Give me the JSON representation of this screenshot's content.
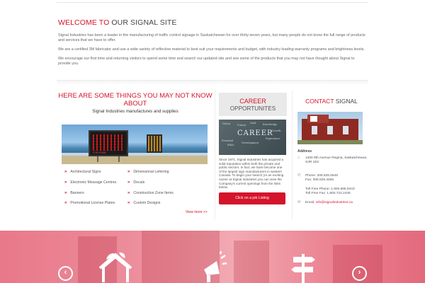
{
  "welcome": {
    "title_red": "WELCOME TO",
    "title_dark": "OUR SIGNAL SITE",
    "p1": "Signal Industries has been a leader in the manufacturing of traffic control signage in Saskatchewan for over thirty-seven years, but many people do not know the full range of products and services that we have to offer.",
    "p2": "We are a certified 3M fabricator and use a wide variety of reflective material to best suit your requirements and budget, with industry leading warranty programs and brightness levels.",
    "p3": "We encourage our first time and returning visitors to spend some time and search our updated site and see some of the products that you may not have thought about Signal to provide you."
  },
  "things": {
    "heading": "HERE ARE SOME THINGS YOU MAY NOT KNOW ABOUT",
    "subheading": "Signal Industries manufactures and supplies",
    "photo_sign_text": "FOR HOME",
    "items": [
      "Architectural Signs",
      "Dimensional Lettering",
      "Electronic Message Centres",
      "Decals",
      "Banners",
      "Construction Zone Items",
      "Promotional License Plates",
      "Custom Designs"
    ],
    "view_more": "View more >>"
  },
  "career": {
    "heading_line1": "CAREER",
    "heading_line2": "OPPORTUNITES",
    "chalk_main": "CAREER",
    "chalk_words": [
      "Vision",
      "Goal",
      "Knowledge",
      "Growth",
      "Potential",
      "Ethic",
      "Future",
      "Experience",
      "Development"
    ],
    "text": "Since 1971, Signal Industries has acquired a solid reputation within both the private and public sectors. In fact, we have become one of the largest sign manufacturers in western Canada. To begin your search (or an exciting career at Signal Industries you can view the Company's current openings from the links below.",
    "button": "Click on a job Listing"
  },
  "contact": {
    "heading_red": "CONTACT",
    "heading_dark": "SIGNAL",
    "address_label": "Address",
    "address": "1300 9th Avenue Regina, Saskatchewan, S4R 1E2",
    "phone": "Phone: 306.525.0548",
    "fax": "Fax: 306.525.3465",
    "tollfree_phone": "Toll Free Phone: 1.800.565.9443",
    "tollfree_fax": "Toll Free Fax: 1.800.723.2436",
    "email_label": "Email:",
    "email": "info@signalindustries.ca"
  },
  "band": {
    "prev_icon": "chevron-left-icon",
    "next_icon": "chevron-right-icon",
    "icons": [
      "eco-house-icon",
      "megaphone-icon",
      "signpost-icon"
    ]
  },
  "colors": {
    "accent": "#d4142b",
    "band": "#ec8c9a"
  }
}
